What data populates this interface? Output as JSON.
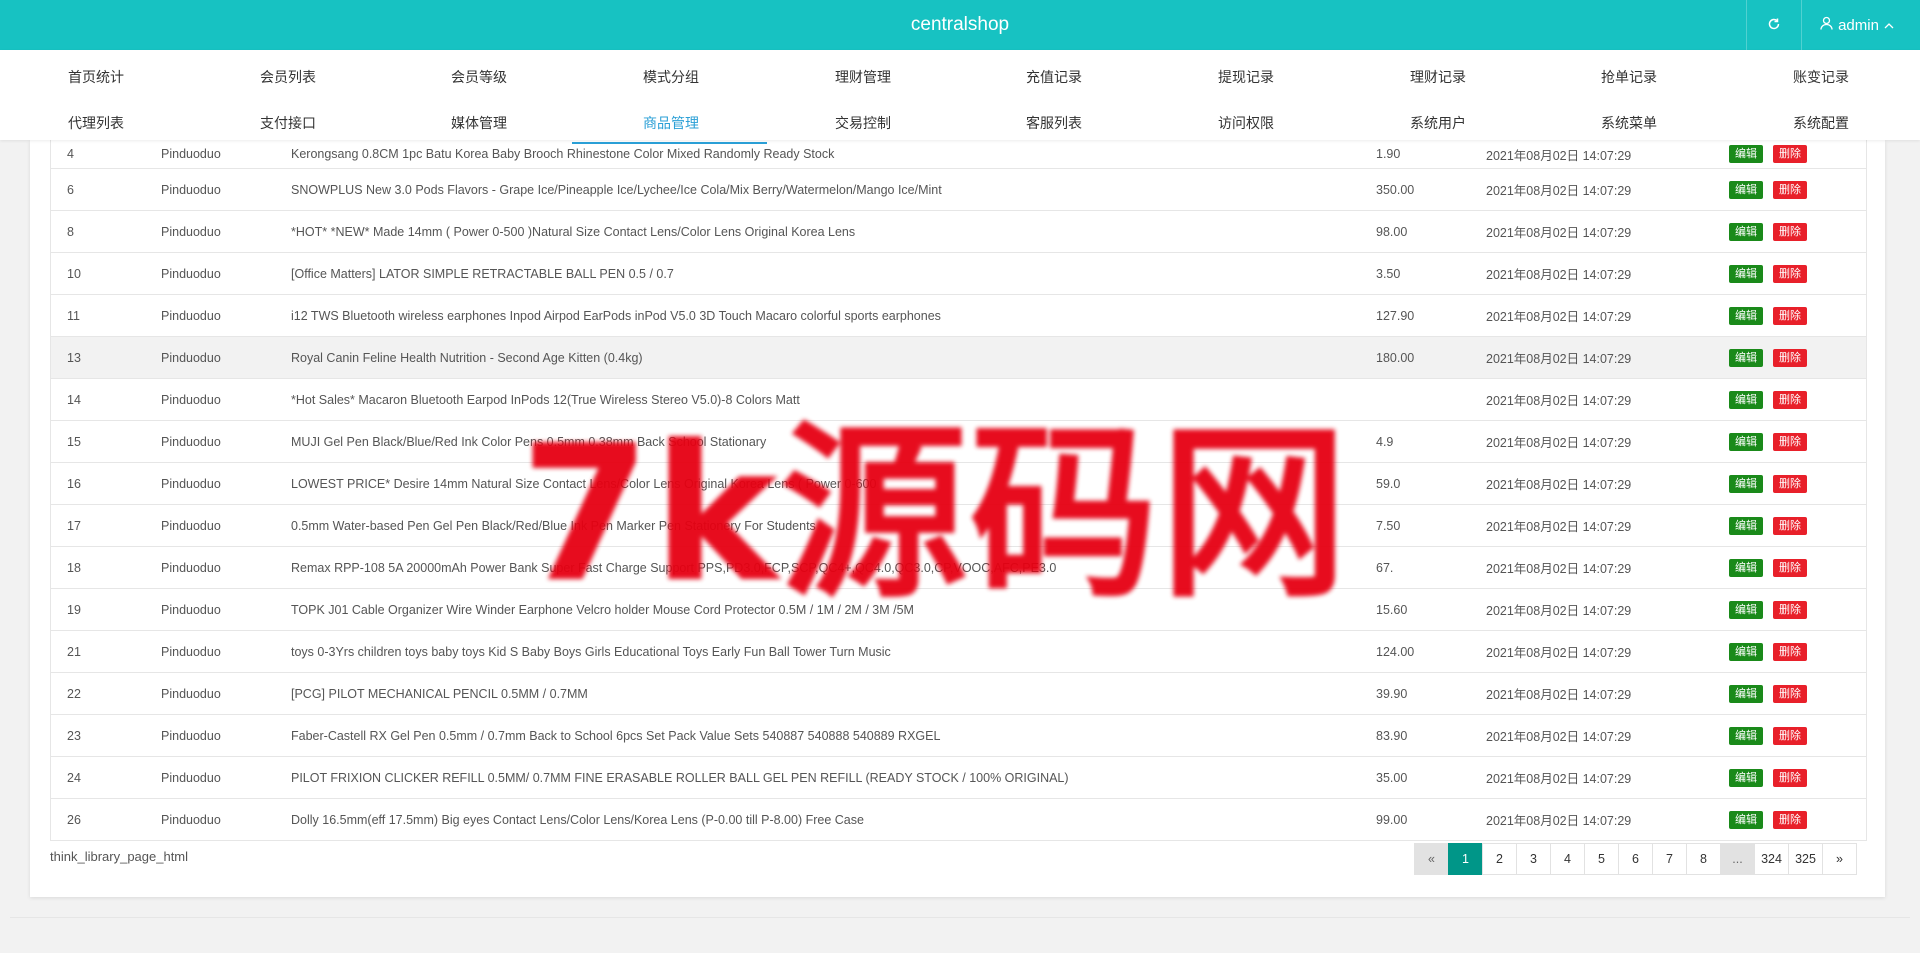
{
  "header": {
    "title": "centralshop",
    "user": "admin"
  },
  "menu": {
    "row1": [
      "首页统计",
      "会员列表",
      "会员等级",
      "模式分组",
      "理财管理",
      "充值记录",
      "提现记录",
      "理财记录",
      "抢单记录",
      "账变记录"
    ],
    "row2": [
      "代理列表",
      "支付接口",
      "媒体管理",
      "商品管理",
      "交易控制",
      "客服列表",
      "访问权限",
      "系统用户",
      "系统菜单",
      "系统配置"
    ],
    "active": "商品管理"
  },
  "table": {
    "edit_label": "编辑",
    "delete_label": "删除",
    "rows": [
      {
        "id": "4",
        "source": "Pinduoduo",
        "name": "Kerongsang 0.8CM 1pc Batu Korea Baby Brooch Rhinestone Color Mixed Randomly Ready Stock",
        "price": "1.90",
        "time": "2021年08月02日 14:07:29"
      },
      {
        "id": "6",
        "source": "Pinduoduo",
        "name": "SNOWPLUS New 3.0 Pods Flavors - Grape Ice/Pineapple Ice/Lychee/Ice Cola/Mix Berry/Watermelon/Mango Ice/Mint",
        "price": "350.00",
        "time": "2021年08月02日 14:07:29"
      },
      {
        "id": "8",
        "source": "Pinduoduo",
        "name": "*HOT* *NEW* Made 14mm ( Power 0-500 )Natural Size Contact Lens/Color Lens Original Korea Lens",
        "price": "98.00",
        "time": "2021年08月02日 14:07:29"
      },
      {
        "id": "10",
        "source": "Pinduoduo",
        "name": "[Office Matters] LATOR SIMPLE RETRACTABLE BALL PEN 0.5 / 0.7",
        "price": "3.50",
        "time": "2021年08月02日 14:07:29"
      },
      {
        "id": "11",
        "source": "Pinduoduo",
        "name": "i12 TWS Bluetooth wireless earphones Inpod Airpod EarPods inPod V5.0 3D Touch Macaro colorful sports earphones",
        "price": "127.90",
        "time": "2021年08月02日 14:07:29"
      },
      {
        "id": "13",
        "source": "Pinduoduo",
        "name": "Royal Canin Feline Health Nutrition - Second Age Kitten (0.4kg)",
        "price": "180.00",
        "time": "2021年08月02日 14:07:29"
      },
      {
        "id": "14",
        "source": "Pinduoduo",
        "name": "*Hot Sales* Macaron Bluetooth Earpod InPods 12(True Wireless Stereo V5.0)-8 Colors Matt",
        "price": "",
        "time": "2021年08月02日 14:07:29"
      },
      {
        "id": "15",
        "source": "Pinduoduo",
        "name": "MUJI Gel Pen Black/Blue/Red Ink Color Pens 0.5mm 0.38mm Back School Stationary",
        "price": "4.9",
        "time": "2021年08月02日 14:07:29"
      },
      {
        "id": "16",
        "source": "Pinduoduo",
        "name": "LOWEST PRICE* Desire 14mm Natural Size Contact Lens/Color Lens Original Korea Lens ( Power 0-600",
        "price": "59.0",
        "time": "2021年08月02日 14:07:29"
      },
      {
        "id": "17",
        "source": "Pinduoduo",
        "name": "0.5mm Water-based Pen Gel Pen Black/Red/Blue Ink Pen Marker Pen Stationery For Students",
        "price": "7.50",
        "time": "2021年08月02日 14:07:29"
      },
      {
        "id": "18",
        "source": "Pinduoduo",
        "name": "Remax RPP-108 5A 20000mAh Power Bank Super Fast Charge Support PPS,PD3.0,FCP,SCP,QC4+,QC4.0,QC3.0,CP,VOOC,AFC,PE3.0",
        "price": "67.",
        "time": "2021年08月02日 14:07:29"
      },
      {
        "id": "19",
        "source": "Pinduoduo",
        "name": "TOPK J01 Cable Organizer Wire Winder Earphone Velcro holder Mouse Cord Protector 0.5M / 1M / 2M / 3M /5M",
        "price": "15.60",
        "time": "2021年08月02日 14:07:29"
      },
      {
        "id": "21",
        "source": "Pinduoduo",
        "name": "toys 0-3Yrs children toys baby toys Kid S Baby Boys Girls Educational Toys Early Fun Ball Tower Turn Music",
        "price": "124.00",
        "time": "2021年08月02日 14:07:29"
      },
      {
        "id": "22",
        "source": "Pinduoduo",
        "name": "[PCG] PILOT MECHANICAL PENCIL 0.5MM / 0.7MM",
        "price": "39.90",
        "time": "2021年08月02日 14:07:29"
      },
      {
        "id": "23",
        "source": "Pinduoduo",
        "name": "Faber-Castell RX Gel Pen 0.5mm / 0.7mm Back to School 6pcs Set Pack Value Sets 540887 540888 540889 RXGEL",
        "price": "83.90",
        "time": "2021年08月02日 14:07:29"
      },
      {
        "id": "24",
        "source": "Pinduoduo",
        "name": "PILOT FRIXION CLICKER REFILL 0.5MM/ 0.7MM FINE ERASABLE ROLLER BALL GEL PEN REFILL (READY STOCK / 100% ORIGINAL)",
        "price": "35.00",
        "time": "2021年08月02日 14:07:29"
      },
      {
        "id": "26",
        "source": "Pinduoduo",
        "name": "Dolly 16.5mm(eff 17.5mm) Big eyes Contact Lens/Color Lens/Korea Lens (P-0.00 till P-8.00) Free Case",
        "price": "99.00",
        "time": "2021年08月02日 14:07:29"
      }
    ]
  },
  "footer": {
    "text": "think_library_page_html"
  },
  "pagination": {
    "prev": "«",
    "pages": [
      "1",
      "2",
      "3",
      "4",
      "5",
      "6",
      "7",
      "8",
      "...",
      "324",
      "325"
    ],
    "current": "1",
    "next": "»"
  },
  "watermark": "7k源码网",
  "colors": {
    "header": "#17c2c2",
    "active_menu": "#2a9fd6",
    "edit": "#1a8a1a",
    "delete": "#e8202a",
    "page_active": "#009688",
    "watermark": "#e60012"
  }
}
